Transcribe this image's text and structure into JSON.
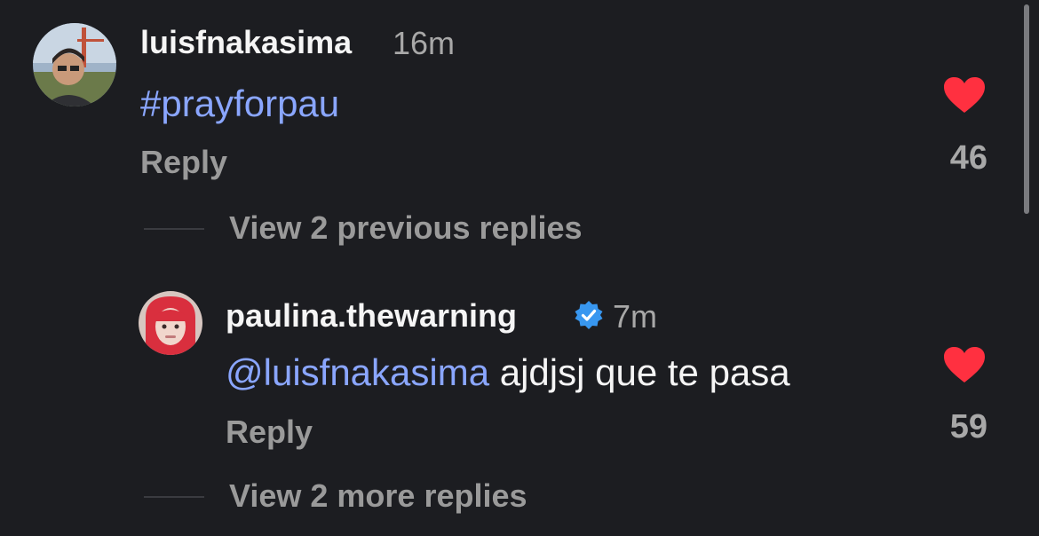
{
  "comments": [
    {
      "username": "luisfnakasima",
      "time": "16m",
      "mention": "",
      "text": "#prayforpau",
      "reply_label": "Reply",
      "likes": "46",
      "view_replies": "View 2 previous replies"
    },
    {
      "username": "paulina.thewarning",
      "verified": true,
      "time": "7m",
      "mention": "@luisfnakasima",
      "text": " ajdjsj que te pasa",
      "reply_label": "Reply",
      "likes": "59",
      "view_replies": "View 2 more replies"
    }
  ],
  "colors": {
    "background": "#1c1d21",
    "mention": "#8aa6ff",
    "heart": "#ff3040",
    "verified": "#3897f0"
  }
}
